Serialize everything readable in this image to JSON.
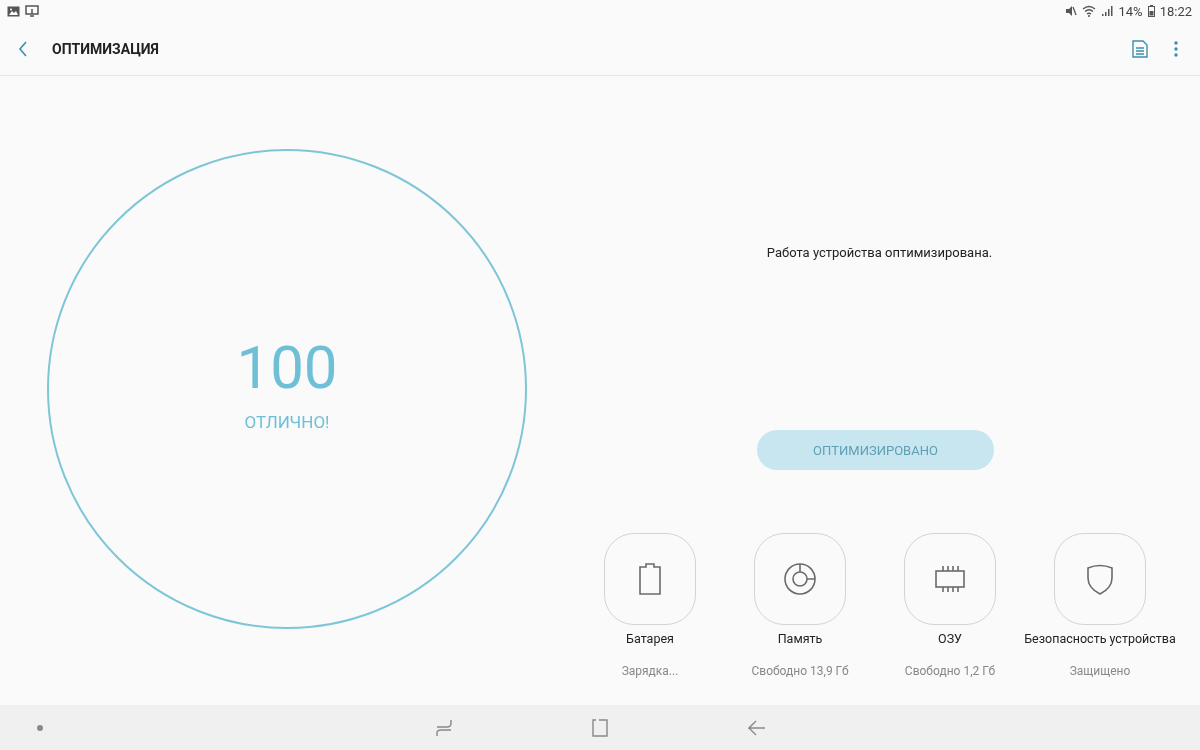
{
  "status_bar": {
    "battery": "14%",
    "time": "18:22"
  },
  "app_bar": {
    "title": "ОПТИМИЗАЦИЯ"
  },
  "score": {
    "value": "100",
    "rating": "ОТЛИЧНО!"
  },
  "message": "Работа устройства оптимизирована.",
  "optimize_button": {
    "label": "ОПТИМИЗИРОВАНО",
    "disabled": true
  },
  "tiles": [
    {
      "kind": "battery",
      "label": "Батарея",
      "detail": "Зарядка..."
    },
    {
      "kind": "storage",
      "label": "Память",
      "detail": "Свободно 13,9 Гб"
    },
    {
      "kind": "ram",
      "label": "ОЗУ",
      "detail": "Свободно 1,2 Гб"
    },
    {
      "kind": "security",
      "label": "Безопасность устройства",
      "detail": "Защищено"
    }
  ]
}
